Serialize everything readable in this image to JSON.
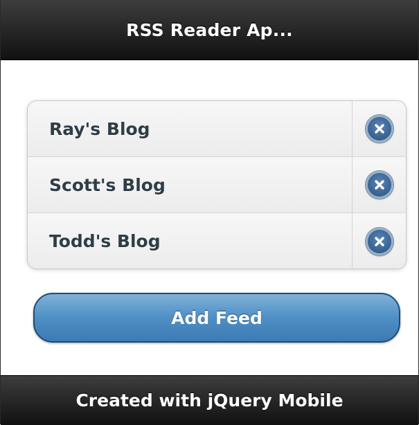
{
  "header": {
    "title": "RSS Reader Ap..."
  },
  "feeds": {
    "items": [
      {
        "label": "Ray's Blog",
        "delete_icon": "delete-icon"
      },
      {
        "label": "Scott's Blog",
        "delete_icon": "delete-icon"
      },
      {
        "label": "Todd's Blog",
        "delete_icon": "delete-icon"
      }
    ]
  },
  "actions": {
    "add_feed_label": "Add Feed"
  },
  "footer": {
    "text": "Created with jQuery Mobile"
  },
  "colors": {
    "bar_background": "#1a1a1a",
    "button_accent": "#4f8fc4",
    "delete_icon": "#3a6595",
    "list_text": "#2f3e46"
  }
}
